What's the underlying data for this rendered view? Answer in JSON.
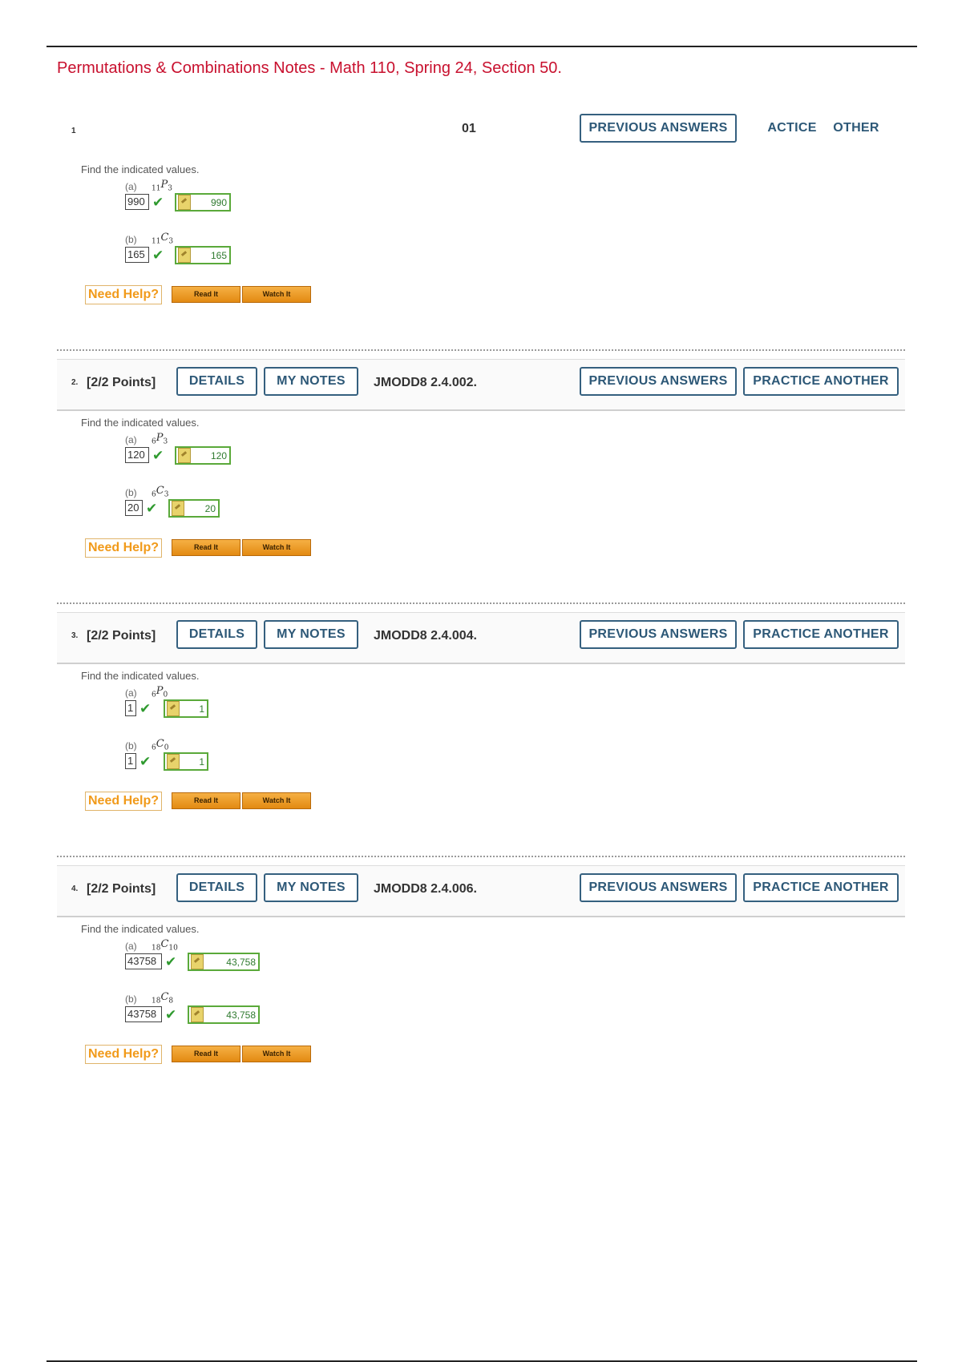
{
  "page_title": "Permutations & Combinations Notes - Math 110, Spring 24, Section 50.",
  "help": {
    "need_help": "Need Help?",
    "read_it": "Read It",
    "watch_it": "Watch It"
  },
  "questions": [
    {
      "number": "1",
      "points": "",
      "code": "01",
      "buttons": {
        "previous_answers": "PREVIOUS ANSWERS",
        "practice": "ACTICE",
        "other": "OTHER"
      },
      "instruction": "Find the indicated values.",
      "parts": [
        {
          "label": "(a)",
          "pre": "11",
          "letter": "P",
          "post": "3",
          "answer": "990",
          "key": "990"
        },
        {
          "label": "(b)",
          "pre": "11",
          "letter": "C",
          "post": "3",
          "answer": "165",
          "key": "165"
        }
      ]
    },
    {
      "number": "2.",
      "points": "[2/2 Points]",
      "code": "JMODD8 2.4.002.",
      "buttons": {
        "details": "DETAILS",
        "my_notes": "MY NOTES",
        "previous_answers": "PREVIOUS ANSWERS",
        "practice_another": "PRACTICE ANOTHER"
      },
      "instruction": "Find the indicated values.",
      "parts": [
        {
          "label": "(a)",
          "pre": "6",
          "letter": "P",
          "post": "3",
          "answer": "120",
          "key": "120"
        },
        {
          "label": "(b)",
          "pre": "6",
          "letter": "C",
          "post": "3",
          "answer": "20",
          "key": "20"
        }
      ]
    },
    {
      "number": "3.",
      "points": "[2/2 Points]",
      "code": "JMODD8 2.4.004.",
      "buttons": {
        "details": "DETAILS",
        "my_notes": "MY NOTES",
        "previous_answers": "PREVIOUS ANSWERS",
        "practice_another": "PRACTICE ANOTHER"
      },
      "instruction": "Find the indicated values.",
      "parts": [
        {
          "label": "(a)",
          "pre": "6",
          "letter": "P",
          "post": "0",
          "answer": "1",
          "key": "1"
        },
        {
          "label": "(b)",
          "pre": "6",
          "letter": "C",
          "post": "0",
          "answer": "1",
          "key": "1"
        }
      ]
    },
    {
      "number": "4.",
      "points": "[2/2 Points]",
      "code": "JMODD8 2.4.006.",
      "buttons": {
        "details": "DETAILS",
        "my_notes": "MY NOTES",
        "previous_answers": "PREVIOUS ANSWERS",
        "practice_another": "PRACTICE ANOTHER"
      },
      "instruction": "Find the indicated values.",
      "parts": [
        {
          "label": "(a)",
          "pre": "18",
          "letter": "C",
          "post": "10",
          "answer": "43758",
          "key": "43,758"
        },
        {
          "label": "(b)",
          "pre": "18",
          "letter": "C",
          "post": "8",
          "answer": "43758",
          "key": "43,758"
        }
      ]
    }
  ]
}
